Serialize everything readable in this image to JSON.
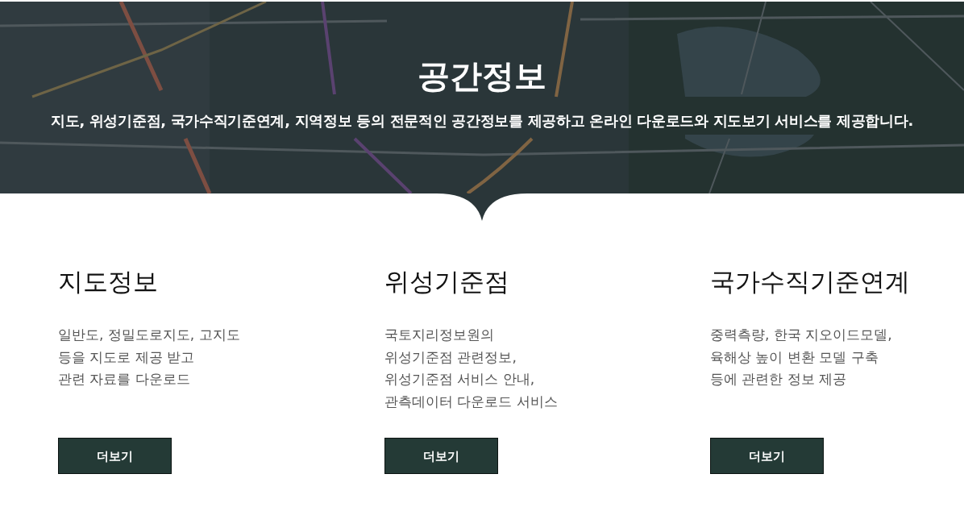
{
  "banner": {
    "title": "공간정보",
    "subtitle": "지도, 위성기준점, 국가수직기준연계, 지역정보 등의 전문적인 공간정보를 제공하고 온라인 다운로드와 지도보기 서비스를 제공합니다."
  },
  "sections": [
    {
      "title": "지도정보",
      "description": [
        "일반도, 정밀도로지도, 고지도",
        "등을 지도로 제공 받고",
        "관련 자료를 다운로드"
      ],
      "button": "더보기"
    },
    {
      "title": "위성기준점",
      "description": [
        "국토지리정보원의",
        "위성기준점 관련정보,",
        "위성기준점 서비스 안내,",
        "관측데이터 다운로드 서비스"
      ],
      "button": "더보기"
    },
    {
      "title": "국가수직기준연계",
      "description": [
        "중력측량, 한국 지오이드모델,",
        "육해상 높이 변환 모델 구축",
        "등에 관련한 정보 제공"
      ],
      "button": "더보기"
    }
  ]
}
